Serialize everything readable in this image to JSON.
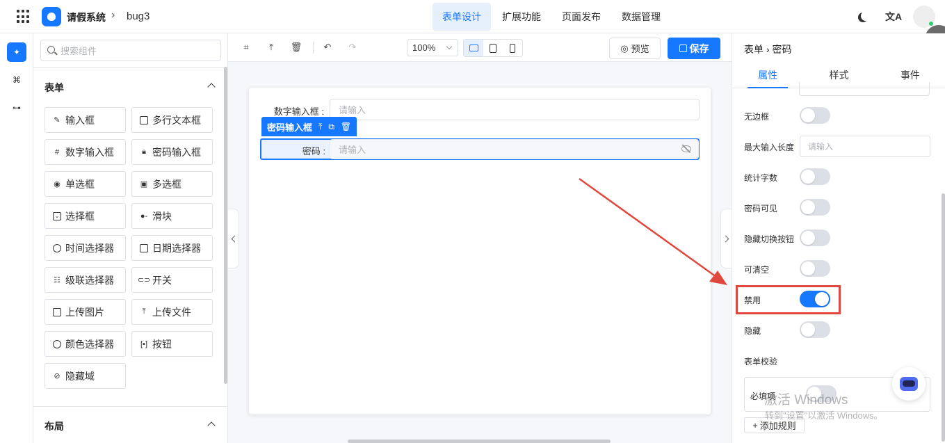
{
  "topbar": {
    "app_title": "请假系统",
    "separator": "›",
    "project_name": "bug3",
    "nav": [
      {
        "label": "表单设计",
        "active": true
      },
      {
        "label": "扩展功能",
        "active": false
      },
      {
        "label": "页面发布",
        "active": false
      },
      {
        "label": "数据管理",
        "active": false
      }
    ],
    "translate_glyph": "文A"
  },
  "components": {
    "search_placeholder": "搜索组件",
    "form_group_title": "表单",
    "form_items": [
      {
        "label": "输入框",
        "icon": "pencil-icon"
      },
      {
        "label": "多行文本框",
        "icon": "textarea-icon"
      },
      {
        "label": "数字输入框",
        "icon": "number-icon"
      },
      {
        "label": "密码输入框",
        "icon": "lock-icon"
      },
      {
        "label": "单选框",
        "icon": "radio-icon"
      },
      {
        "label": "多选框",
        "icon": "checkbox-icon"
      },
      {
        "label": "选择框",
        "icon": "select-icon"
      },
      {
        "label": "滑块",
        "icon": "slider-icon"
      },
      {
        "label": "时间选择器",
        "icon": "clock-icon"
      },
      {
        "label": "日期选择器",
        "icon": "calendar-icon"
      },
      {
        "label": "级联选择器",
        "icon": "cascader-icon"
      },
      {
        "label": "开关",
        "icon": "switch-icon"
      },
      {
        "label": "上传图片",
        "icon": "image-icon"
      },
      {
        "label": "上传文件",
        "icon": "upload-icon"
      },
      {
        "label": "颜色选择器",
        "icon": "palette-icon"
      },
      {
        "label": "按钮",
        "icon": "button-icon"
      },
      {
        "label": "隐藏域",
        "icon": "eye-off-icon"
      }
    ],
    "layout_group_title": "布局"
  },
  "toolbar": {
    "zoom": "100%",
    "preview_label": "预览",
    "save_label": "保存"
  },
  "canvas": {
    "number_field_label": "数字输入框 :",
    "number_field_placeholder": "请输入",
    "selected_tag_label": "密码输入框",
    "password_field_label": "密码 :",
    "password_field_placeholder": "请输入"
  },
  "properties": {
    "breadcrumb": "表单 › 密码",
    "tabs": [
      {
        "label": "属性",
        "active": true
      },
      {
        "label": "样式",
        "active": false
      },
      {
        "label": "事件",
        "active": false
      }
    ],
    "no_border_label": "无边框",
    "max_length_label": "最大输入长度",
    "max_length_placeholder": "请输入",
    "show_word_limit_label": "统计字数",
    "show_password_label": "密码可见",
    "hide_toggle_label": "隐藏切换按钮",
    "clearable_label": "可清空",
    "disabled_label": "禁用",
    "hidden_label": "隐藏",
    "validation_title": "表单校验",
    "required_label": "必填项",
    "add_rule_label": "添加规则",
    "toggles": {
      "no_border": false,
      "show_word_limit": false,
      "show_password": false,
      "hide_toggle": false,
      "clearable": false,
      "disabled": true,
      "hidden": false,
      "required": false
    }
  },
  "watermark": {
    "line1": "激活 Windows",
    "line2": "转到\"设置\"以激活 Windows。"
  },
  "colors": {
    "primary": "#1677ff",
    "annotation_red": "#e0483f"
  }
}
